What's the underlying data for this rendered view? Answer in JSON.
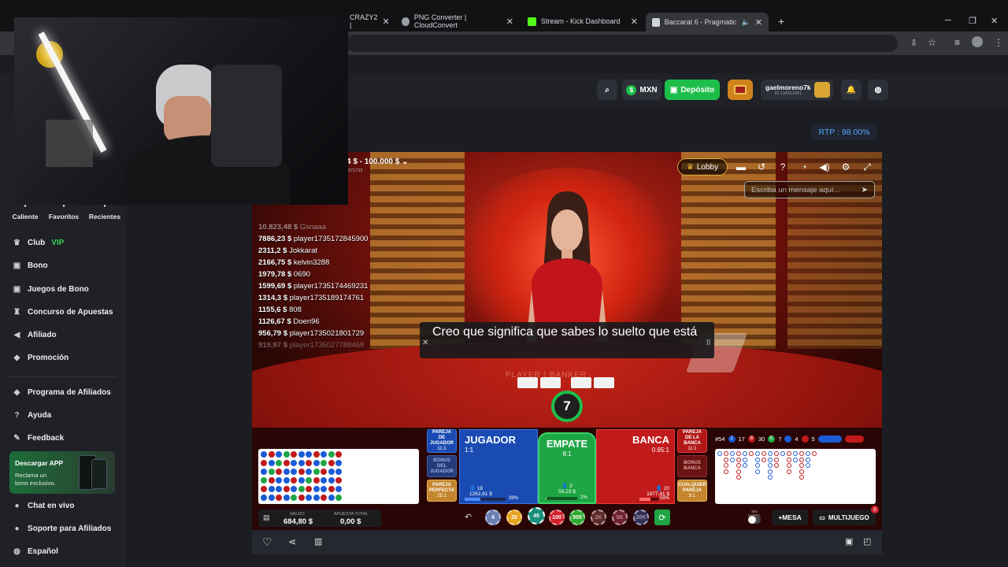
{
  "browser": {
    "tabs": [
      {
        "label": "CRAZY2 |",
        "color": "#6f6f6f"
      },
      {
        "label": "PNG Converter | CloudConvert",
        "color": "#9aa0a6"
      },
      {
        "label": "Stream - Kick Dashboard",
        "color": "#53fc18"
      },
      {
        "label": "Baccarat 6 - Pragmatic Play",
        "color": "#cfd2d6"
      }
    ],
    "new_tab": "+"
  },
  "header": {
    "currency": "MXN",
    "deposit": "Depósito",
    "username": "gaelmoreno7k",
    "user_id": "ID:134311041"
  },
  "rtp": "RTP : 98.00%",
  "sidebar": {
    "quick": [
      {
        "label": "Caliente"
      },
      {
        "label": "Favoritos"
      },
      {
        "label": "Recientes"
      }
    ],
    "items": [
      {
        "label": "Club",
        "badge": "VIP",
        "icon": "crown-icon"
      },
      {
        "label": "Bono",
        "icon": "gift-icon"
      },
      {
        "label": "Juegos de Bono",
        "icon": "gift-icon"
      },
      {
        "label": "Concurso de Apuestas",
        "icon": "trophy-icon"
      },
      {
        "label": "Afiliado",
        "icon": "megaphone-icon"
      },
      {
        "label": "Promoción",
        "icon": "tag-icon"
      },
      {
        "label": "Programa de Afiliados",
        "icon": "handshake-icon"
      },
      {
        "label": "Ayuda",
        "icon": "help-icon"
      },
      {
        "label": "Feedback",
        "icon": "feedback-icon"
      }
    ],
    "app_promo": {
      "title": "Descargar APP",
      "line1": "Reclama un",
      "line2": "bono exclusivo."
    },
    "bottom": [
      {
        "label": "Chat en vivo"
      },
      {
        "label": "Soporte para Afiliados"
      },
      {
        "label": "Español"
      }
    ]
  },
  "game": {
    "bet_limits": "4 $ - 100.000 $",
    "table_id": "371723",
    "lobby": "Lobby",
    "chat_placeholder": "Escriba un mensaje aquí...",
    "winners": [
      {
        "amount": "10.823,48 $",
        "name": "Gsnaaa"
      },
      {
        "amount": "7886,23 $",
        "name": "player1735172845900"
      },
      {
        "amount": "2311,2 $",
        "name": "Jokkarat"
      },
      {
        "amount": "2166,75 $",
        "name": "kelvin3288"
      },
      {
        "amount": "1979,78 $",
        "name": "0690"
      },
      {
        "amount": "1599,69 $",
        "name": "player1735174469231"
      },
      {
        "amount": "1314,3 $",
        "name": "player1735189174761"
      },
      {
        "amount": "1155,6 $",
        "name": "808"
      },
      {
        "amount": "1126,67 $",
        "name": "Doen96"
      },
      {
        "amount": "956,79 $",
        "name": "player1735021801729"
      },
      {
        "amount": "919,97 $",
        "name": "player1735027788468"
      }
    ],
    "subtitle": "Creo que significa que sabes lo suelto que está",
    "table_text": "PLAYER | BANKER",
    "countdown": "7",
    "bets": {
      "player_pair": {
        "line1": "PAREJA",
        "line2": "DE",
        "line3": "JUGADOR",
        "odds": "11:1"
      },
      "player_bonus": {
        "line1": "BONUS",
        "line2": "DEL",
        "line3": "JUGADOR"
      },
      "perfect_pair": {
        "line1": "PAREJA",
        "line2": "PERFECTA",
        "odds": "25:1"
      },
      "player": {
        "label": "JUGADOR",
        "odds": "1:1",
        "players": "18",
        "amount": "1262,61 $",
        "pct": "39%",
        "pct_value": 39
      },
      "tie": {
        "label": "EMPATE",
        "odds": "8:1",
        "players": "3",
        "amount": "56,23 $",
        "pct": "2%",
        "pct_value": 2
      },
      "banker": {
        "label": "BANCA",
        "odds": "0.95:1",
        "players": "20",
        "amount": "1877,41 $",
        "pct": "59%",
        "pct_value": 59
      },
      "banker_pair": {
        "line1": "PAREJA",
        "line2": "DE LA",
        "line3": "BANCA",
        "odds": "11:1"
      },
      "banker_bonus": {
        "line1": "BONUS",
        "line2": "BANCA"
      },
      "either_pair": {
        "line1": "CUALQUIER",
        "line2": "PAREJA",
        "odds": "5:1"
      }
    },
    "stats": {
      "round": "#54",
      "player_count": "17",
      "banker_count": "30",
      "tie_count": "7",
      "player_pairs": "4",
      "banker_pairs": "5"
    },
    "balance": {
      "label": "SALDO",
      "value": "684,80 $"
    },
    "total_bet": {
      "label": "APUESTA TOTAL",
      "value": "0,00 $"
    },
    "chips": [
      "4",
      "20",
      "40",
      "100",
      "500",
      "2K",
      "5K",
      "20K"
    ],
    "no_comm": "SIN COMIS.",
    "more_tables": "+MESA",
    "multigame": "MULTIJUEGO",
    "multigame_badge": "8"
  },
  "colors": {
    "deposit": "#1dbf4a",
    "player_blue": "#1a5bd6",
    "banker_red": "#c11a1a",
    "tie_green": "#1fa644",
    "accent_gold": "#d7a93c"
  }
}
